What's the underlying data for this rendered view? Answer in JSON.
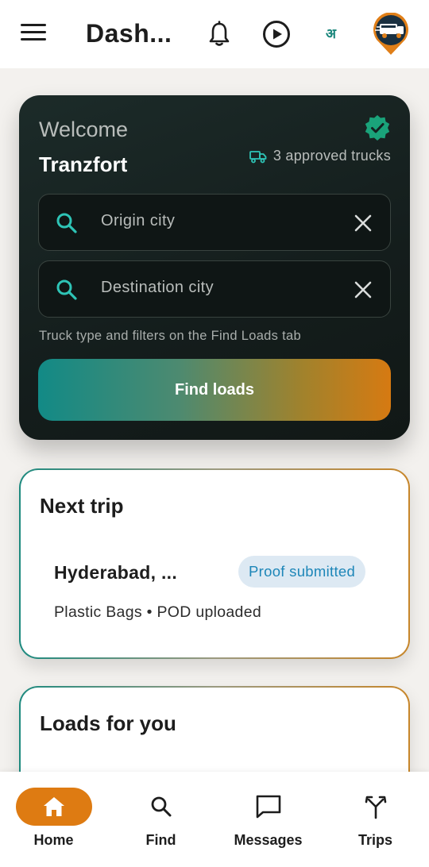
{
  "header": {
    "title": "Dash...",
    "language_toggle": "अ",
    "icons": [
      "menu-icon",
      "bell-icon",
      "play-circle-icon",
      "logo-avatar"
    ]
  },
  "welcome": {
    "greeting": "Welcome",
    "company": "Tranzfort",
    "approved_trucks": "3 approved trucks",
    "origin_placeholder": "Origin city",
    "destination_placeholder": "Destination city",
    "hint": "Truck type and filters on the Find Loads tab",
    "find_button": "Find loads"
  },
  "next_trip": {
    "title": "Next trip",
    "route": "Hyderabad, ...",
    "status": "Proof submitted",
    "meta": "Plastic Bags • POD uploaded"
  },
  "loads": {
    "title": "Loads for you"
  },
  "nav": {
    "items": [
      {
        "label": "Home",
        "icon": "home-icon",
        "active": true
      },
      {
        "label": "Find",
        "icon": "search-icon",
        "active": false
      },
      {
        "label": "Messages",
        "icon": "message-icon",
        "active": false
      },
      {
        "label": "Trips",
        "icon": "route-split-icon",
        "active": false
      }
    ]
  },
  "colors": {
    "accent_orange": "#de7b12",
    "accent_teal": "#17857a",
    "card_dark": "#141d1c",
    "status_blue": "#1d86b8"
  }
}
